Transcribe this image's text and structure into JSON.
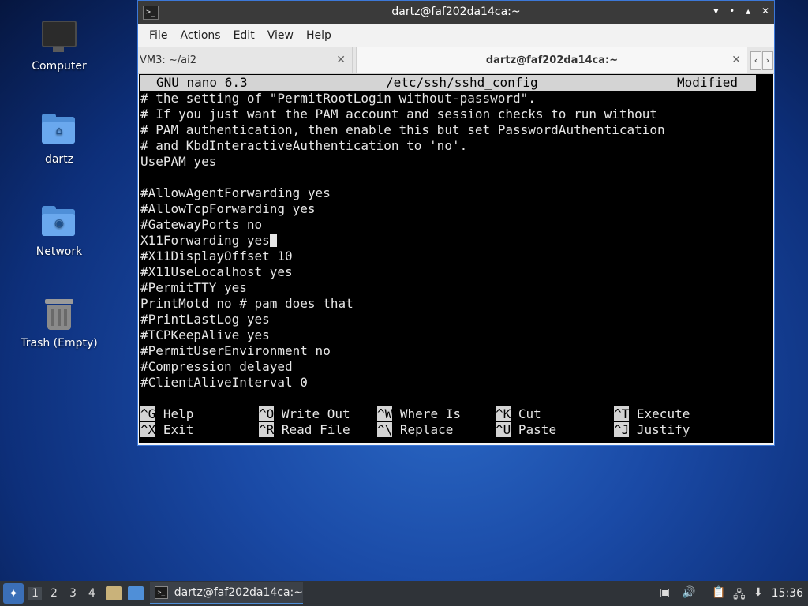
{
  "desktop": {
    "icons": [
      {
        "label": "Computer"
      },
      {
        "label": "dartz"
      },
      {
        "label": "Network"
      },
      {
        "label": "Trash (Empty)"
      }
    ]
  },
  "window": {
    "title": "dartz@faf202da14ca:~",
    "controls": {
      "minimize": "▾",
      "restore": "•",
      "maximize": "▴",
      "close": "✕"
    },
    "menu": [
      "File",
      "Actions",
      "Edit",
      "View",
      "Help"
    ],
    "tabs": [
      {
        "label": "VM3: ~/ai2",
        "close": "✕"
      },
      {
        "label": "dartz@faf202da14ca:~",
        "close": "✕"
      }
    ],
    "tab_arrows": {
      "left": "‹",
      "right": "›"
    }
  },
  "nano": {
    "version": "GNU nano 6.3",
    "file": "/etc/ssh/sshd_config",
    "status": "Modified",
    "lines": [
      "# the setting of \"PermitRootLogin without-password\".",
      "# If you just want the PAM account and session checks to run without",
      "# PAM authentication, then enable this but set PasswordAuthentication",
      "# and KbdInteractiveAuthentication to 'no'.",
      "UsePAM yes",
      "",
      "#AllowAgentForwarding yes",
      "#AllowTcpForwarding yes",
      "#GatewayPorts no",
      "X11Forwarding yes",
      "#X11DisplayOffset 10",
      "#X11UseLocalhost yes",
      "#PermitTTY yes",
      "PrintMotd no # pam does that",
      "#PrintLastLog yes",
      "#TCPKeepAlive yes",
      "#PermitUserEnvironment no",
      "#Compression delayed",
      "#ClientAliveInterval 0"
    ],
    "shortcuts": [
      {
        "key": "^G",
        "label": "Help"
      },
      {
        "key": "^O",
        "label": "Write Out"
      },
      {
        "key": "^W",
        "label": "Where Is"
      },
      {
        "key": "^K",
        "label": "Cut"
      },
      {
        "key": "^T",
        "label": "Execute"
      },
      {
        "key": "^X",
        "label": "Exit"
      },
      {
        "key": "^R",
        "label": "Read File"
      },
      {
        "key": "^\\",
        "label": "Replace"
      },
      {
        "key": "^U",
        "label": "Paste"
      },
      {
        "key": "^J",
        "label": "Justify"
      }
    ]
  },
  "taskbar": {
    "start_icon": "start-menu-icon",
    "workspaces": [
      "1",
      "2",
      "3",
      "4"
    ],
    "task_label": "dartz@faf202da14ca:~",
    "clock": "15:36"
  }
}
